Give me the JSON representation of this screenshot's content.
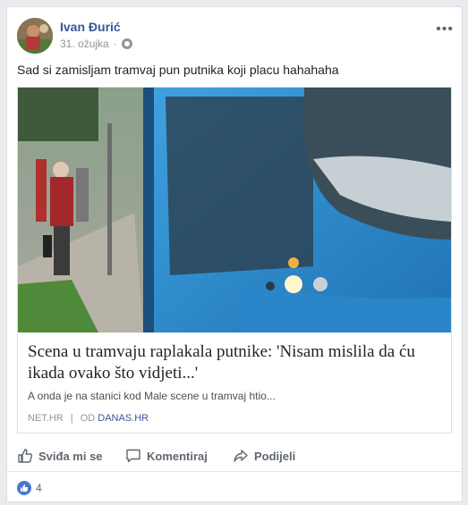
{
  "post": {
    "author": "Ivan Đurić",
    "date": "31. ožujka",
    "meta_separator": "·",
    "text": "Sad si zamisljam tramvaj pun putnika koji placu hahahaha"
  },
  "link": {
    "title": "Scena u tramvaju raplakala putnike: 'Nisam mislila da ću ikada ovako što vidjeti...'",
    "description": "A onda je na stanici kod Male scene u tramvaj htio...",
    "source": "NET.HR",
    "source_separator": "|",
    "via_prefix": "OD",
    "via": "DANAS.HR"
  },
  "actions": {
    "like": "Sviđa mi se",
    "comment": "Komentiraj",
    "share": "Podijeli"
  },
  "reactions": {
    "count": "4"
  },
  "colors": {
    "accent": "#365899",
    "tram_blue": "#2f8fd0",
    "like_blue": "#4a76d4"
  }
}
